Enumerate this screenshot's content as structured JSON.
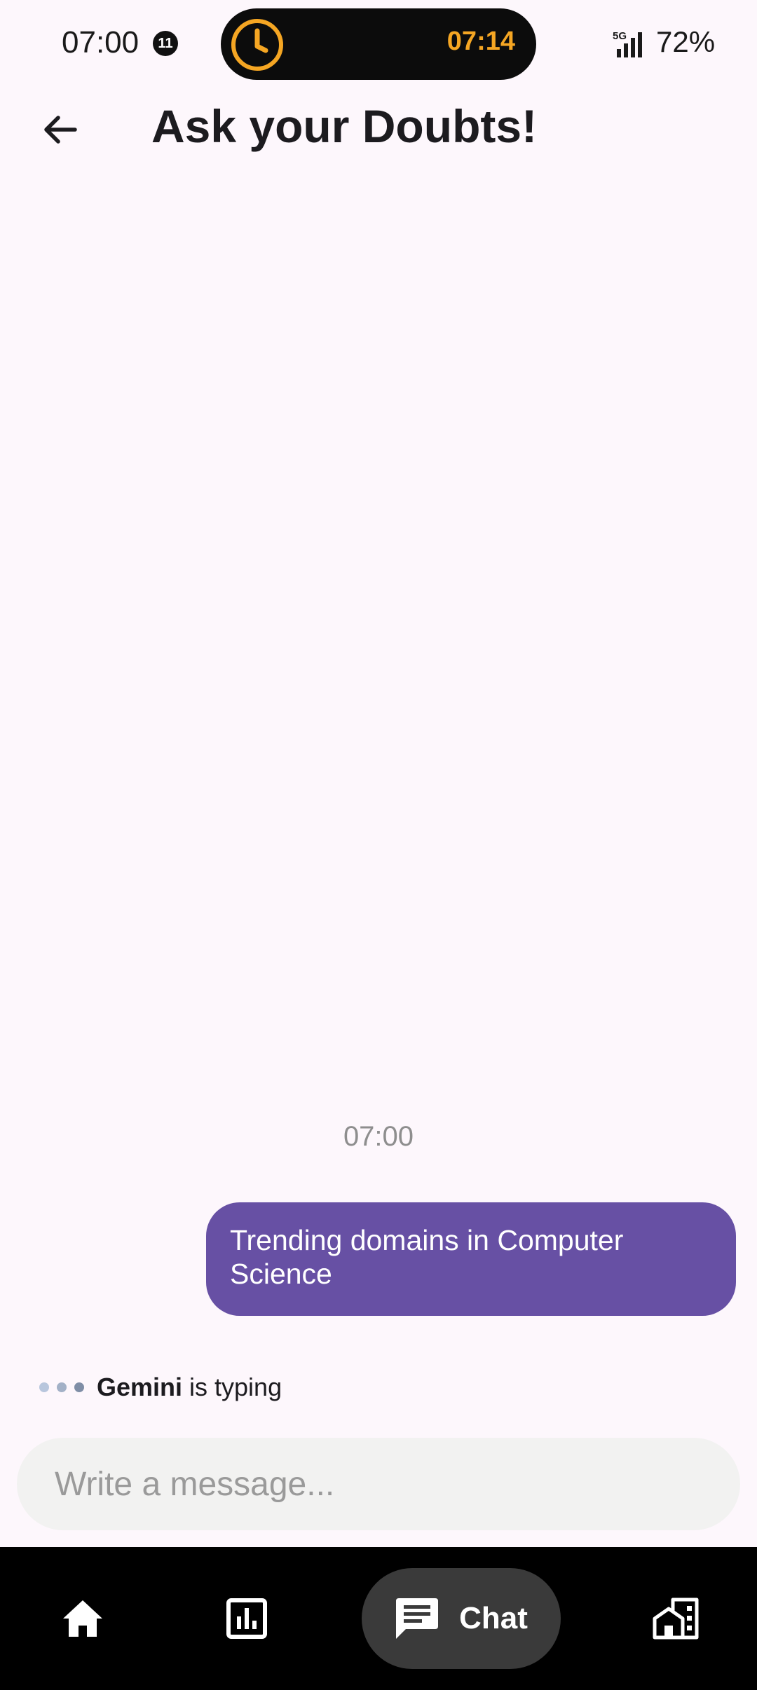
{
  "status_bar": {
    "time": "07:00",
    "notification_count": "11",
    "island_time": "07:14",
    "network": "5G",
    "battery": "72%"
  },
  "app_bar": {
    "title": "Ask your Doubts!"
  },
  "chat": {
    "timestamp": "07:00",
    "messages": [
      {
        "sender": "user",
        "text": "Trending domains in Computer Science"
      }
    ],
    "typing": {
      "name": "Gemini",
      "status": "is typing"
    }
  },
  "composer": {
    "placeholder": "Write a message..."
  },
  "bottom_nav": {
    "items": [
      {
        "icon": "home-icon"
      },
      {
        "icon": "bar-chart-icon"
      },
      {
        "icon": "chat-icon",
        "label": "Chat",
        "active": true
      },
      {
        "icon": "organization-icon"
      }
    ]
  },
  "colors": {
    "accent": "#6750a4",
    "island_text": "#f5a623",
    "background": "#fdf7fc"
  }
}
